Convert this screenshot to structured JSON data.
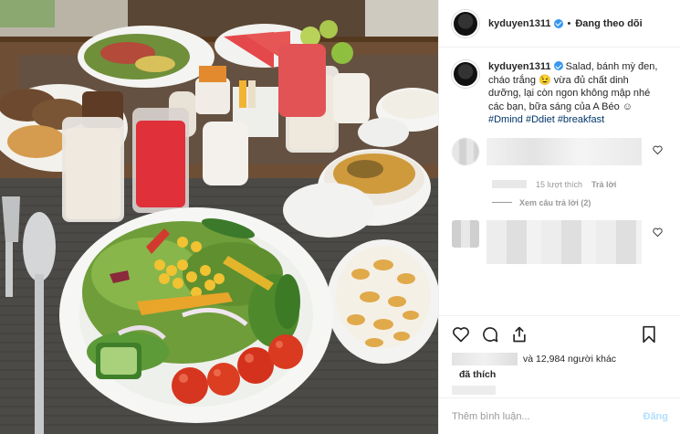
{
  "header": {
    "username": "kyduyen1311",
    "separator": "•",
    "follow_status": "Đang theo dõi"
  },
  "caption": {
    "username": "kyduyen1311",
    "text": "Salad, bánh mỳ đen, cháo trắng 😉 vừa đủ chất dinh dưỡng, lại còn ngon không mập nhé các bạn, bữa sáng của A Béo ☺",
    "hashtags": "#Dmind #Ddiet #breakfast"
  },
  "comments": {
    "comment1_likes": "15 lượt thích",
    "comment1_reply": "Trả lời",
    "view_replies": "Xem câu trả lời (2)"
  },
  "likes": {
    "others_text": "và 12,984 người khác",
    "liked_label": "đã thích"
  },
  "add_comment": {
    "placeholder": "Thêm bình luận...",
    "post_label": "Đăng"
  },
  "icons": [
    "verified-icon",
    "heart-icon",
    "comment-icon",
    "share-icon",
    "bookmark-icon"
  ],
  "colors": {
    "verified": "#3897f0",
    "hashtag": "#003569",
    "post_button": "#b2dffc"
  }
}
